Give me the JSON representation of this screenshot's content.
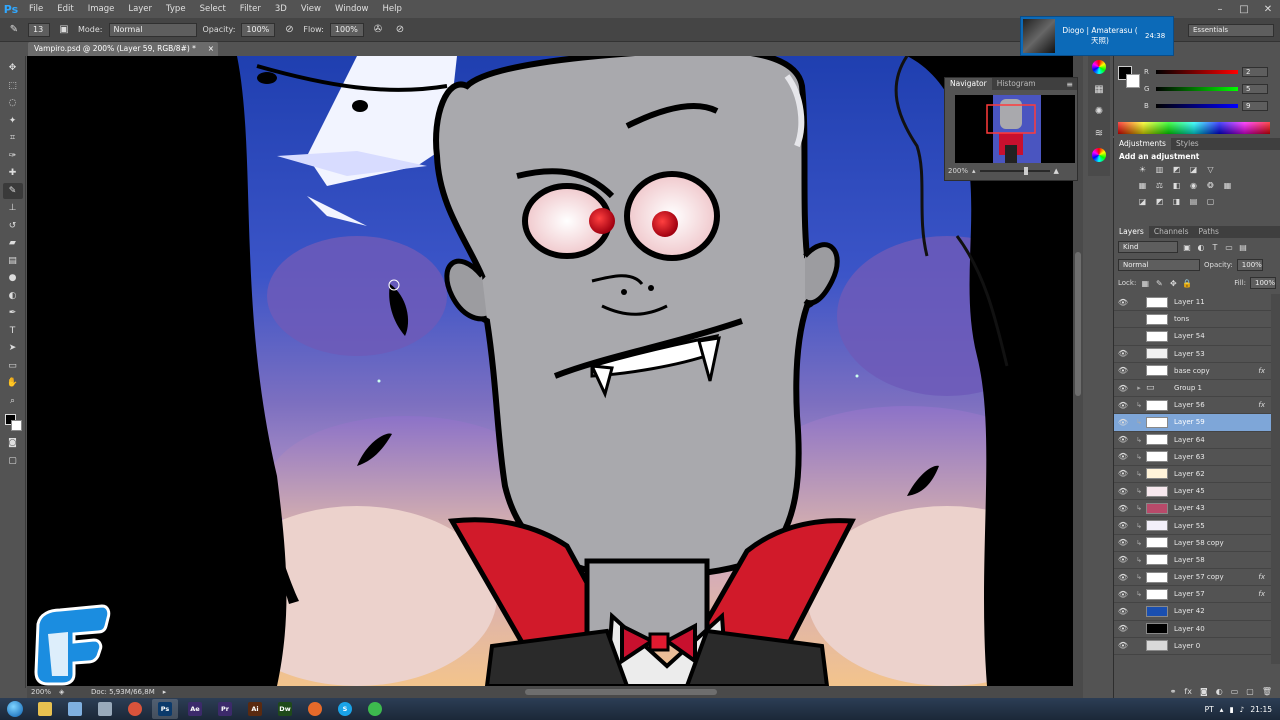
{
  "menu": {
    "app_icon": "Ps",
    "items": [
      "File",
      "Edit",
      "Image",
      "Layer",
      "Type",
      "Select",
      "Filter",
      "3D",
      "View",
      "Window",
      "Help"
    ]
  },
  "options": {
    "brush_size": "13",
    "mode_label": "Mode:",
    "mode_value": "Normal",
    "opacity_label": "Opacity:",
    "opacity_value": "100%",
    "flow_label": "Flow:",
    "flow_value": "100%"
  },
  "notification": {
    "title": "Diogo | Amaterasu ( 天照)",
    "time": "24:38"
  },
  "workspace": "Essentials",
  "document": {
    "tab_title": "Vampiro.psd @ 200% (Layer 59, RGB/8#) *",
    "zoom": "200%",
    "doc_info": "Doc: 5,93M/66,8M"
  },
  "navigator": {
    "tabs": [
      "Navigator",
      "Histogram"
    ],
    "zoom": "200%"
  },
  "color_panel": {
    "channels": [
      {
        "label": "R",
        "value": "2",
        "bar": "linear-gradient(to right,#000,#f00)"
      },
      {
        "label": "G",
        "value": "5",
        "bar": "linear-gradient(to right,#000,#0f0)"
      },
      {
        "label": "B",
        "value": "9",
        "bar": "linear-gradient(to right,#000,#00f)"
      }
    ]
  },
  "adjustments": {
    "tabs": [
      "Adjustments",
      "Styles"
    ],
    "title": "Add an adjustment"
  },
  "layers_panel": {
    "tabs": [
      "Layers",
      "Channels",
      "Paths"
    ],
    "filter": "Kind",
    "blend_mode": "Normal",
    "opacity_label": "Opacity:",
    "opacity_value": "100%",
    "lock_label": "Lock:",
    "fill_label": "Fill:",
    "fill_value": "100%",
    "layers": [
      {
        "name": "Layer 11",
        "visible": true,
        "clip": false,
        "fx": false,
        "thumb": "#ffffff",
        "selected": false
      },
      {
        "name": "tons",
        "visible": false,
        "clip": false,
        "fx": false,
        "thumb": "#ffffff",
        "selected": false
      },
      {
        "name": "Layer 54",
        "visible": false,
        "clip": false,
        "fx": false,
        "thumb": "#ffffff",
        "selected": false
      },
      {
        "name": "Layer 53",
        "visible": true,
        "clip": false,
        "fx": false,
        "thumb": "#f0f0f0",
        "selected": false
      },
      {
        "name": "base copy",
        "visible": true,
        "clip": false,
        "fx": true,
        "thumb": "#ffffff",
        "selected": false
      },
      {
        "name": "Group 1",
        "visible": true,
        "clip": false,
        "fx": false,
        "thumb": "folder",
        "selected": false
      },
      {
        "name": "Layer 56",
        "visible": true,
        "clip": true,
        "fx": true,
        "thumb": "#ffffff",
        "selected": false
      },
      {
        "name": "Layer 59",
        "visible": true,
        "clip": true,
        "fx": false,
        "thumb": "#ffffff",
        "selected": true
      },
      {
        "name": "Layer 64",
        "visible": true,
        "clip": true,
        "fx": false,
        "thumb": "#ffffff",
        "selected": false
      },
      {
        "name": "Layer 63",
        "visible": true,
        "clip": true,
        "fx": false,
        "thumb": "#ffffff",
        "selected": false
      },
      {
        "name": "Layer 62",
        "visible": true,
        "clip": true,
        "fx": false,
        "thumb": "#fff3d9",
        "selected": false
      },
      {
        "name": "Layer 45",
        "visible": true,
        "clip": true,
        "fx": false,
        "thumb": "#f7e8ee",
        "selected": false
      },
      {
        "name": "Layer 43",
        "visible": true,
        "clip": true,
        "fx": false,
        "thumb": "#b84a6a",
        "selected": false
      },
      {
        "name": "Layer 55",
        "visible": true,
        "clip": true,
        "fx": false,
        "thumb": "#f3f0fa",
        "selected": false
      },
      {
        "name": "Layer 58 copy",
        "visible": true,
        "clip": true,
        "fx": false,
        "thumb": "#ffffff",
        "selected": false
      },
      {
        "name": "Layer 58",
        "visible": true,
        "clip": true,
        "fx": false,
        "thumb": "#ffffff",
        "selected": false
      },
      {
        "name": "Layer 57 copy",
        "visible": true,
        "clip": true,
        "fx": true,
        "thumb": "#ffffff",
        "selected": false
      },
      {
        "name": "Layer 57",
        "visible": true,
        "clip": true,
        "fx": true,
        "thumb": "#ffffff",
        "selected": false
      },
      {
        "name": "Layer 42",
        "visible": true,
        "clip": false,
        "fx": false,
        "thumb": "#1a4fb0",
        "selected": false
      },
      {
        "name": "Layer 40",
        "visible": true,
        "clip": false,
        "fx": false,
        "thumb": "#000000",
        "selected": false
      },
      {
        "name": "Layer 0",
        "visible": true,
        "clip": false,
        "fx": false,
        "thumb": "#d9d9d9",
        "selected": false
      }
    ]
  },
  "taskbar": {
    "apps": [
      {
        "name": "explorer",
        "label": "",
        "color": "#e8c150"
      },
      {
        "name": "notepad",
        "label": "",
        "color": "#7fb0e0"
      },
      {
        "name": "tool",
        "label": "",
        "color": "#9ab"
      },
      {
        "name": "chrome",
        "label": "",
        "color": "#d9533b"
      },
      {
        "name": "photoshop",
        "label": "Ps",
        "color": "#0b3a6b"
      },
      {
        "name": "aftereffects",
        "label": "Ae",
        "color": "#3c2a6b"
      },
      {
        "name": "premiere",
        "label": "Pr",
        "color": "#3c2a6b"
      },
      {
        "name": "illustrator",
        "label": "Ai",
        "color": "#5a2a10"
      },
      {
        "name": "dreamweaver",
        "label": "Dw",
        "color": "#1f4a1a"
      },
      {
        "name": "firefox",
        "label": "",
        "color": "#e66a2a"
      },
      {
        "name": "skype",
        "label": "S",
        "color": "#1aa3e8"
      },
      {
        "name": "spotify",
        "label": "",
        "color": "#3dba4e"
      }
    ],
    "lang": "PT",
    "time": "21:15"
  },
  "colors": {
    "accent": "#0c6ab8",
    "selection": "#7ea6d8"
  }
}
